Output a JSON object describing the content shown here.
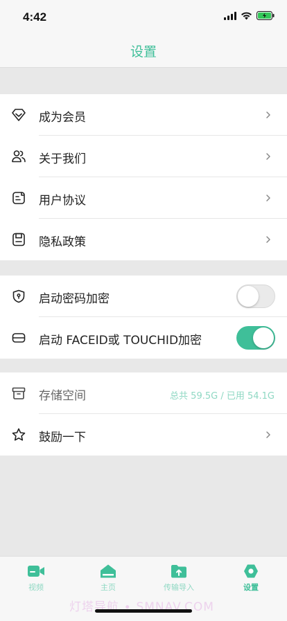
{
  "status_bar": {
    "time": "4:42"
  },
  "nav": {
    "title": "设置"
  },
  "section_1": {
    "items": [
      {
        "label": "成为会员",
        "icon": "diamond-icon"
      },
      {
        "label": "关于我们",
        "icon": "people-icon"
      },
      {
        "label": "用户协议",
        "icon": "document-icon"
      },
      {
        "label": "隐私政策",
        "icon": "save-file-icon"
      }
    ]
  },
  "section_2": {
    "items": [
      {
        "label": "启动密码加密",
        "icon": "shield-icon",
        "enabled": false
      },
      {
        "label": "启动 FACEID或 TOUCHID加密",
        "icon": "card-icon",
        "enabled": true
      }
    ]
  },
  "section_3": {
    "storage": {
      "label": "存储空间",
      "icon": "archive-icon",
      "value": "总共 59.5G / 已用 54.1G"
    },
    "encourage": {
      "label": "鼓励一下",
      "icon": "star-icon"
    }
  },
  "tab_bar": {
    "tabs": [
      {
        "label": "视频",
        "icon": "video-camera-icon"
      },
      {
        "label": "主页",
        "icon": "home-icon"
      },
      {
        "label": "传输导入",
        "icon": "folder-upload-icon"
      },
      {
        "label": "设置",
        "icon": "settings-icon",
        "active": true
      }
    ]
  },
  "watermark": "灯塔导航 ∙ SMNAV.COM",
  "colors": {
    "accent": "#3fbf99",
    "accent_light": "#8fd8c3",
    "background": "#e8e8e8",
    "card": "#ffffff"
  }
}
